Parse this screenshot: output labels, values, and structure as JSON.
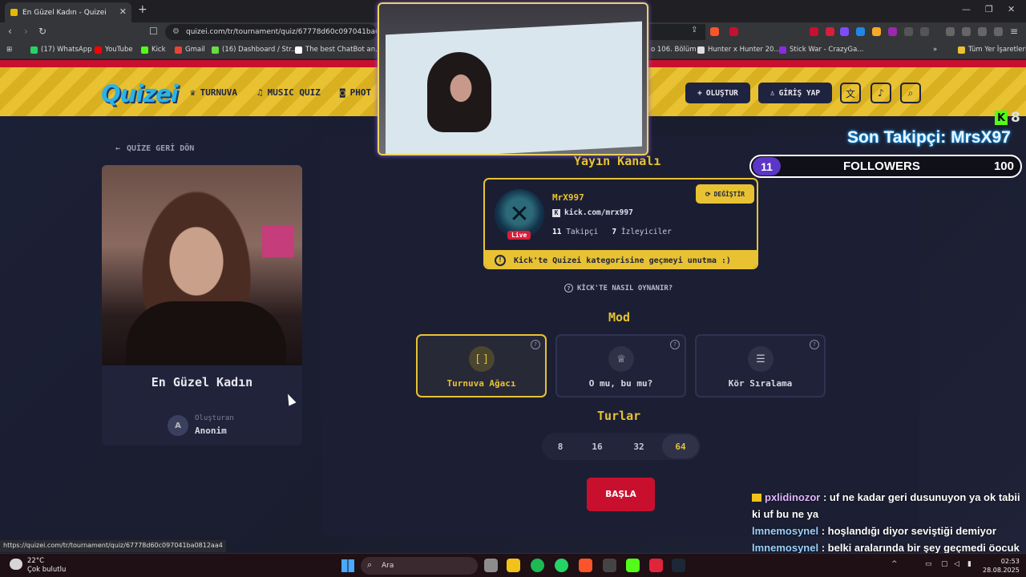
{
  "browser": {
    "tab_title": "En Güzel Kadın - Quizei",
    "url": "quizei.com/tr/tournament/quiz/67778d60c097041ba0812",
    "status_url": "https://quizei.com/tr/tournament/quiz/67778d60c097041ba0812aa4",
    "bookmarks": [
      {
        "label": "(17) WhatsApp",
        "color": "#25d366"
      },
      {
        "label": "YouTube",
        "color": "#ff0000"
      },
      {
        "label": "Kick",
        "color": "#53fc18"
      },
      {
        "label": "Gmail",
        "color": "#ea4335"
      },
      {
        "label": "(16) Dashboard / Str...",
        "color": "#6adb42"
      },
      {
        "label": "The best ChatBot an...",
        "color": "#ffffff"
      },
      {
        "label": "o 106. Bölüm",
        "color": "#888888"
      },
      {
        "label": "Hunter x Hunter 20...",
        "color": "#dddddd"
      },
      {
        "label": "Stick War - CrazyGa...",
        "color": "#8a2be2"
      }
    ],
    "all_bookmarks_label": "Tüm Yer İşaretleri"
  },
  "header": {
    "logo": "Quizei",
    "nav": [
      "TURNUVA",
      "MUSIC QUIZ",
      "PHOT"
    ],
    "create_label": "OLUŞTUR",
    "login_label": "GİRİŞ YAP"
  },
  "sidebar": {
    "back_label": "QUİZE GERİ DÖN",
    "quiz_title": "En Güzel Kadın",
    "creator_label": "Oluşturan",
    "creator_name": "Anonim",
    "creator_initial": "A"
  },
  "channel": {
    "section_title": "Yayın Kanalı",
    "name": "MrX997",
    "url": "kick.com/mrx997",
    "followers_count": "11",
    "followers_label": "Takipçi",
    "viewers_count": "7",
    "viewers_label": "İzleyiciler",
    "live_label": "Live",
    "change_label": "DEĞİŞTİR",
    "warning": "Kick'te Quizei kategorisine geçmeyi unutma :)",
    "howto_label": "KİCK'TE NASIL OYNANIR?"
  },
  "mode": {
    "title": "Mod",
    "options": [
      {
        "label": "Turnuva Ağacı",
        "icon": "bracket-icon",
        "active": true
      },
      {
        "label": "O mu, bu mu?",
        "icon": "crown-icon",
        "active": false
      },
      {
        "label": "Kör Sıralama",
        "icon": "list-icon",
        "active": false
      }
    ]
  },
  "rounds": {
    "title": "Turlar",
    "options": [
      "8",
      "16",
      "32",
      "64"
    ],
    "selected": "64"
  },
  "start_label": "BAŞLA",
  "overlay": {
    "kick_count": "8",
    "last_follower": "Son Takipçi: MrsX97",
    "followers_current": "11",
    "followers_label": "FOLLOWERS",
    "followers_goal": "100",
    "chat": [
      {
        "user": "pxlidinozor",
        "text": "uf ne kadar geri dusunuyon ya ok tabii ki uf bu ne ya"
      },
      {
        "user": "lmnemosynel",
        "text": "hoşlandığı diyor seviştiği demiyor"
      },
      {
        "user": "lmnemosynel",
        "text": "belki aralarında bir şey geçmedi öocuk kızdan nefret ediyordu"
      }
    ]
  },
  "taskbar": {
    "temp": "22°C",
    "weather": "Çok bulutlu",
    "search": "Ara",
    "time": "02:53",
    "date": "28.08.2025"
  }
}
